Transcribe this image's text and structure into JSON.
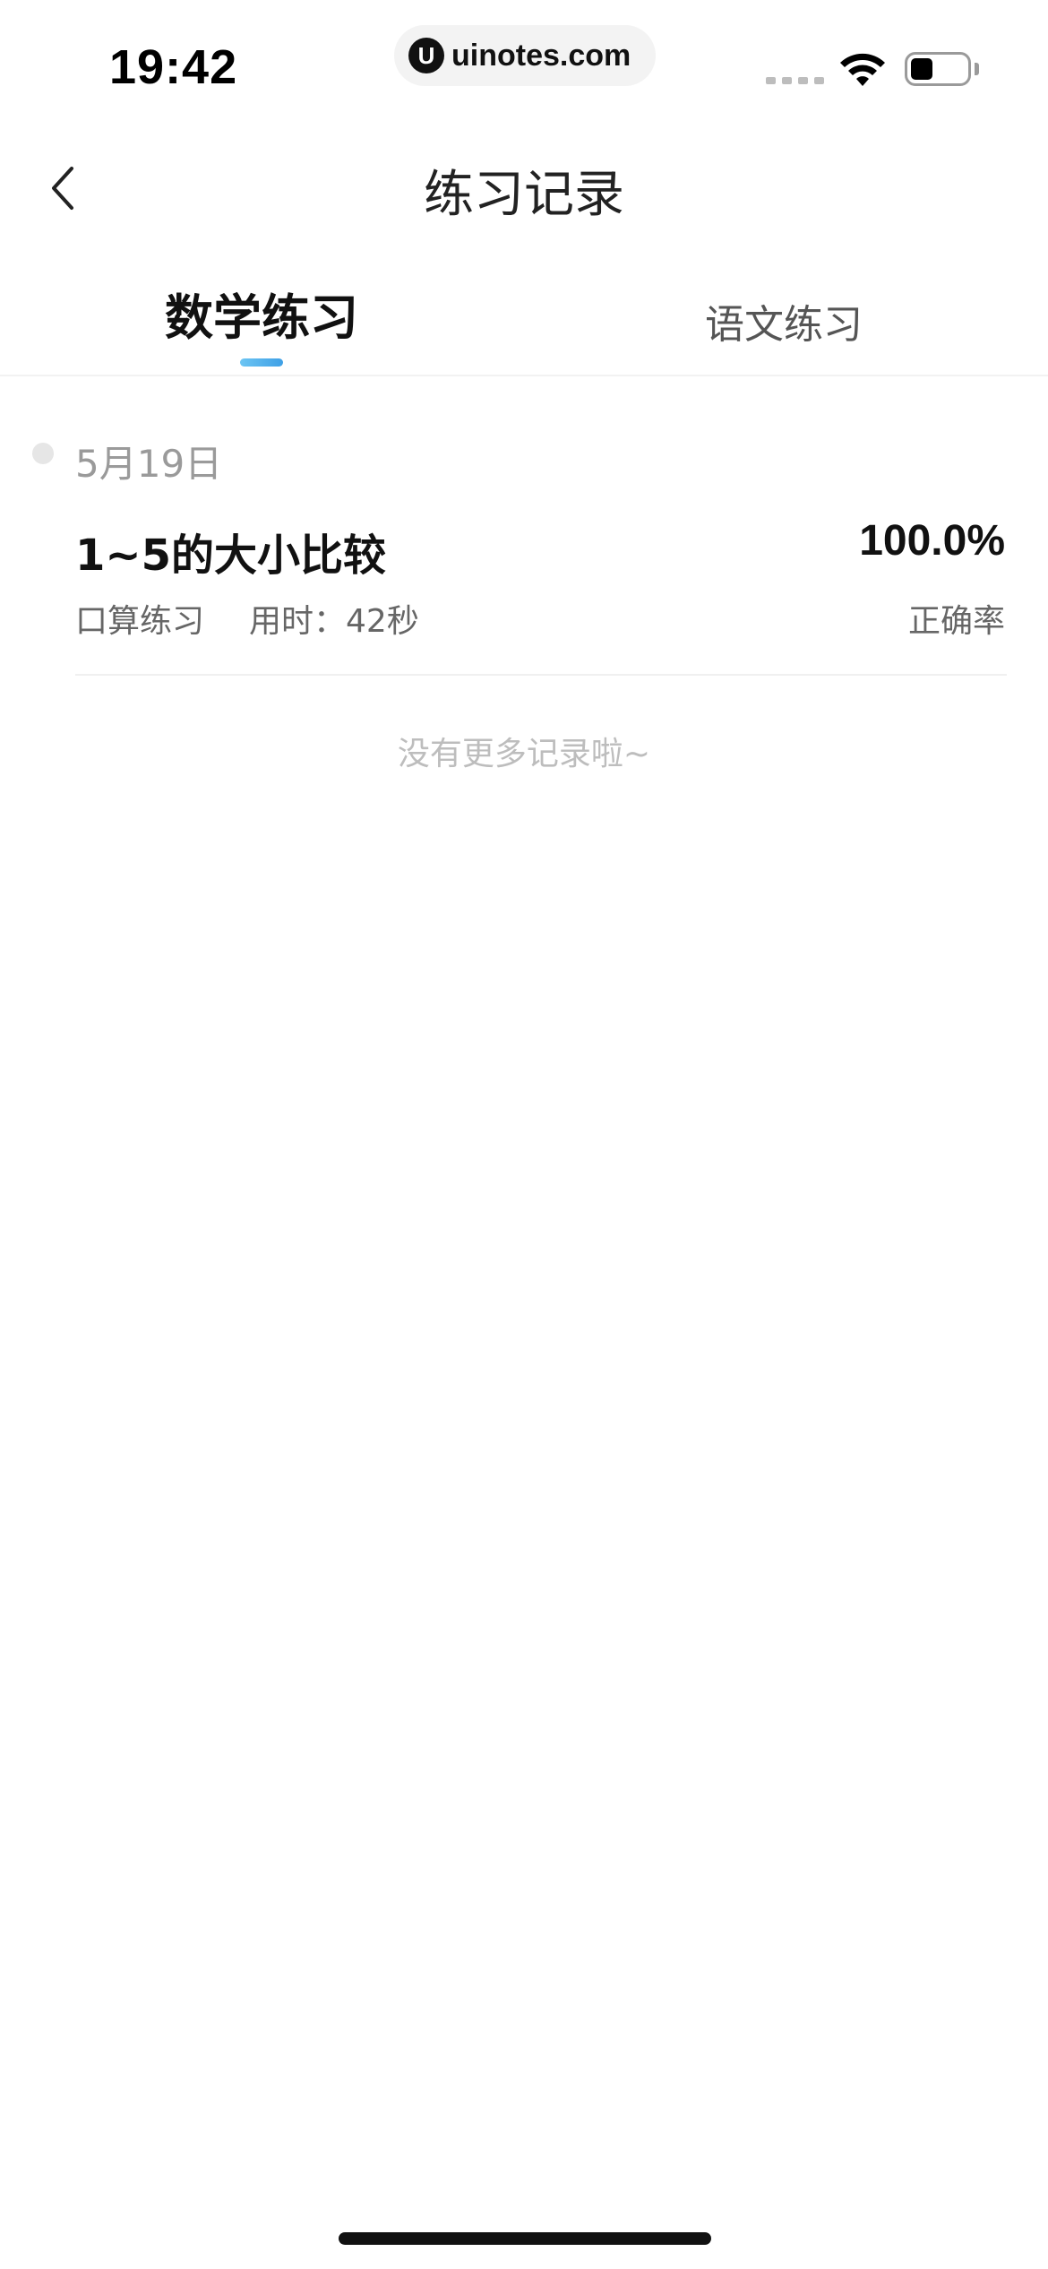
{
  "status_bar": {
    "time": "19:42",
    "url": "uinotes.com",
    "logo_glyph": "U",
    "icons": [
      "signal-icon",
      "wifi-icon",
      "battery-icon"
    ]
  },
  "nav": {
    "title": "练习记录",
    "back_icon": "chevron-left-icon"
  },
  "tabs": [
    {
      "label": "数学练习",
      "active": true
    },
    {
      "label": "语文练习",
      "active": false
    }
  ],
  "accent_color": "#3fa0e6",
  "records": {
    "groups": [
      {
        "date": "5月19日",
        "items": [
          {
            "title": "1~5的大小比较",
            "type": "口算练习",
            "duration": "用时：42秒",
            "score": "100.0%",
            "score_label": "正确率"
          }
        ]
      }
    ],
    "empty_text": "没有更多记录啦~"
  }
}
